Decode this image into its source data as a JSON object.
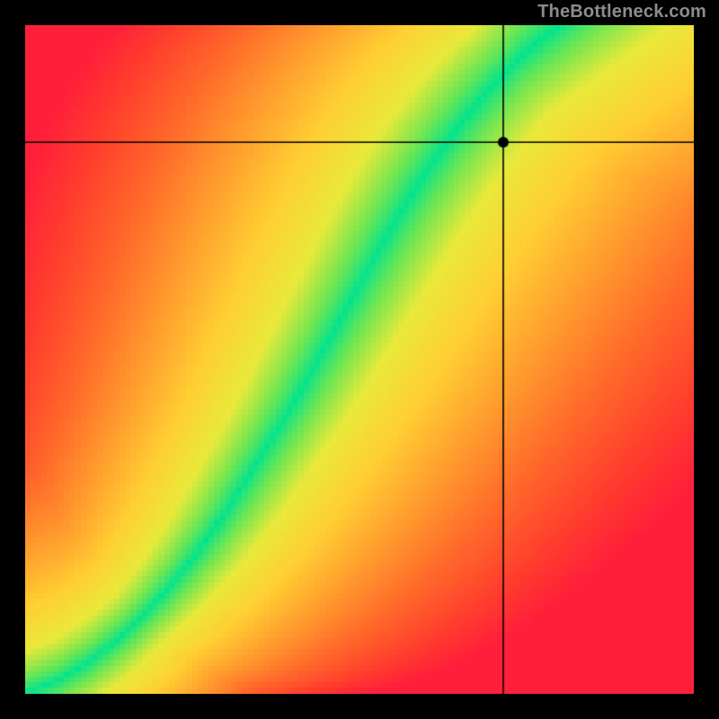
{
  "watermark": "TheBottleneck.com",
  "chart_data": {
    "type": "heatmap",
    "title": "",
    "xlabel": "",
    "ylabel": "",
    "x_range": [
      0,
      1
    ],
    "y_range": [
      0,
      1
    ],
    "marker": {
      "x": 0.715,
      "y": 0.825
    },
    "crosshair": {
      "x": 0.715,
      "y": 0.825
    },
    "optimal_curve": [
      {
        "x": 0.0,
        "y": 0.0
      },
      {
        "x": 0.05,
        "y": 0.02
      },
      {
        "x": 0.1,
        "y": 0.05
      },
      {
        "x": 0.15,
        "y": 0.09
      },
      {
        "x": 0.2,
        "y": 0.14
      },
      {
        "x": 0.25,
        "y": 0.2
      },
      {
        "x": 0.3,
        "y": 0.27
      },
      {
        "x": 0.35,
        "y": 0.35
      },
      {
        "x": 0.4,
        "y": 0.43
      },
      {
        "x": 0.45,
        "y": 0.52
      },
      {
        "x": 0.5,
        "y": 0.61
      },
      {
        "x": 0.55,
        "y": 0.7
      },
      {
        "x": 0.6,
        "y": 0.78
      },
      {
        "x": 0.65,
        "y": 0.85
      },
      {
        "x": 0.7,
        "y": 0.91
      },
      {
        "x": 0.75,
        "y": 0.96
      },
      {
        "x": 0.8,
        "y": 1.0
      }
    ],
    "color_stops": [
      {
        "t": 0.0,
        "color": "#00e38f"
      },
      {
        "t": 0.1,
        "color": "#6fe652"
      },
      {
        "t": 0.22,
        "color": "#e9e93a"
      },
      {
        "t": 0.38,
        "color": "#ffcf33"
      },
      {
        "t": 0.55,
        "color": "#ff9e2e"
      },
      {
        "t": 0.72,
        "color": "#ff6a2a"
      },
      {
        "t": 0.88,
        "color": "#ff3d2d"
      },
      {
        "t": 1.0,
        "color": "#ff1f3a"
      }
    ],
    "pixelation": 120,
    "canvas_size": 744
  }
}
